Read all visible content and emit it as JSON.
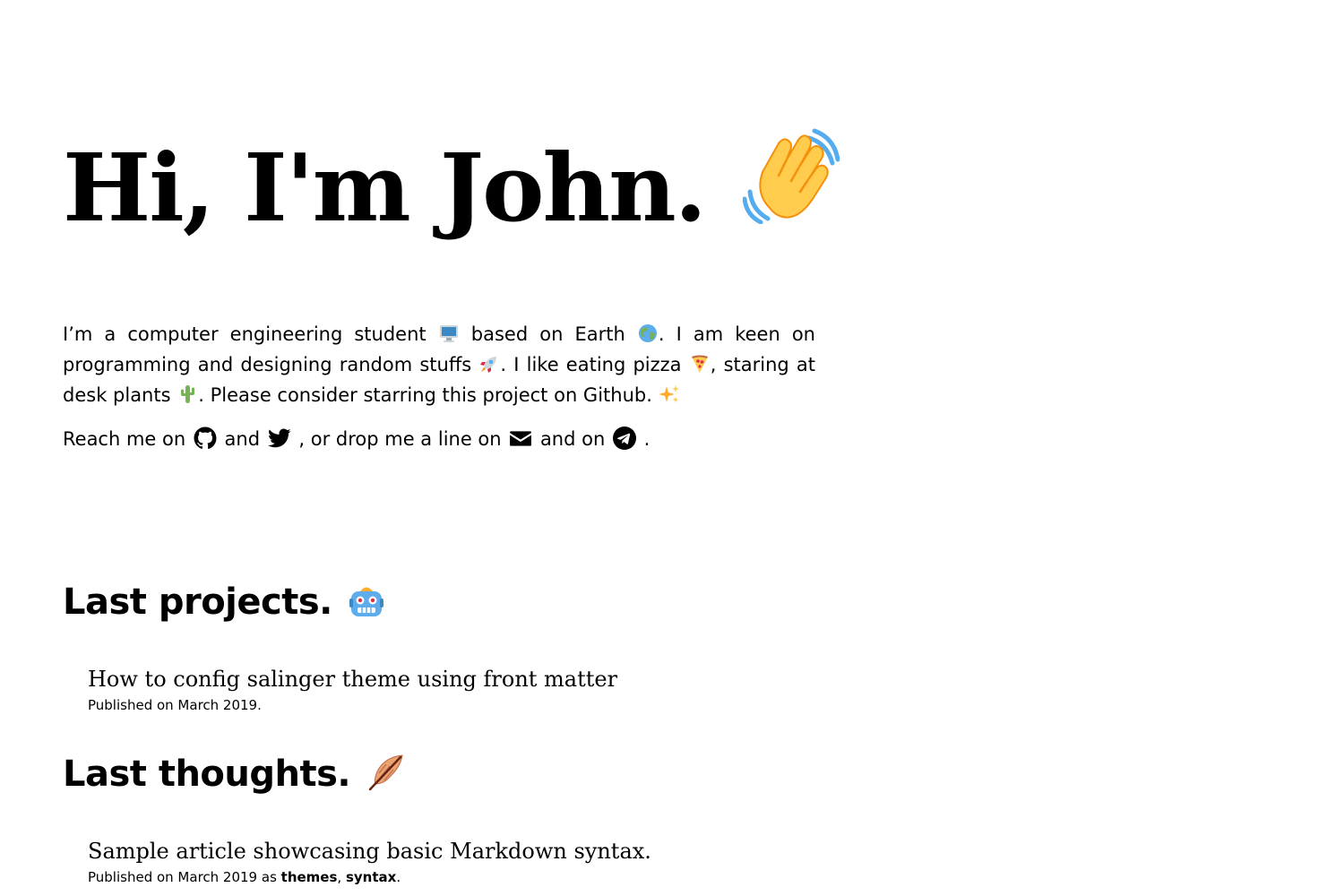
{
  "hero": {
    "title": "Hi, I'm John.",
    "emoji_icon": "waving-hand-icon"
  },
  "intro": {
    "part1": "I’m a computer engineering student ",
    "part2": " based on Earth ",
    "part3": ". I am keen on programming and designing random stuffs ",
    "part4": ". I like eating pizza ",
    "part5": ", staring at desk plants ",
    "part6": ". Please consider starring this project on Github. ",
    "icons": [
      "computer-icon",
      "globe-icon",
      "rocket-icon",
      "pizza-icon",
      "cactus-icon",
      "sparkles-icon"
    ]
  },
  "reach": {
    "part1": "Reach me on ",
    "part2": " and ",
    "part3": " , or drop me a line on ",
    "part4": " and on ",
    "part5": " .",
    "icons": [
      "github-icon",
      "twitter-icon",
      "email-icon",
      "telegram-icon"
    ]
  },
  "projects": {
    "title": "Last projects.",
    "icon": "robot-icon",
    "posts": [
      {
        "title": "How to config salinger theme using front matter",
        "meta": "Published on March 2019."
      }
    ]
  },
  "thoughts": {
    "title": "Last thoughts.",
    "icon": "feather-icon",
    "posts": [
      {
        "title": "Sample article showcasing basic Markdown syntax.",
        "meta_prefix": "Published on March 2019 as ",
        "tags": [
          "themes",
          "syntax"
        ],
        "tag_separator": ", ",
        "meta_suffix": "."
      }
    ]
  }
}
